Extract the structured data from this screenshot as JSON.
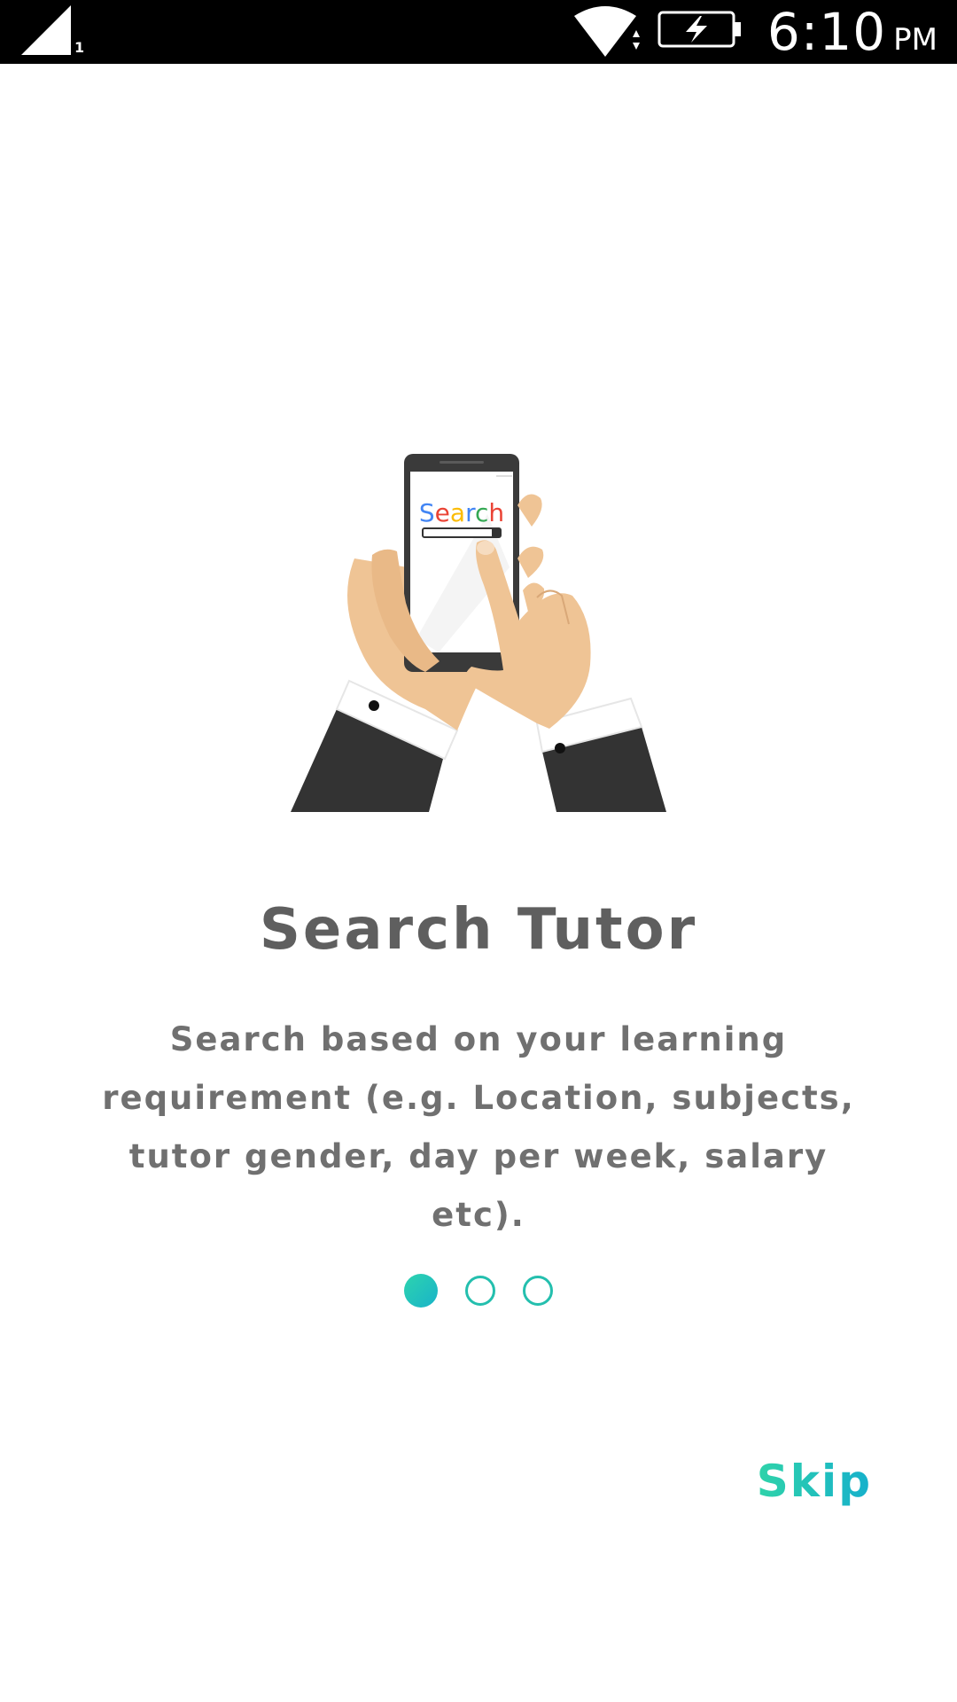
{
  "status_bar": {
    "sim_index": "1",
    "time": "6:10",
    "ampm": "PM",
    "icons": [
      "cell-signal-icon",
      "wifi-icon",
      "battery-charging-icon"
    ]
  },
  "onboarding": {
    "illustration_search_text": "Search",
    "title": "Search Tutor",
    "description_lines": [
      "Search based on your learning",
      "requirement (e.g. Location, subjects,",
      "tutor gender, day per week, salary etc)."
    ],
    "pager": {
      "total": 3,
      "active": 1
    },
    "skip_label": "Skip"
  },
  "colors": {
    "accent_start": "#2dd4ae",
    "accent_end": "#19b3c9",
    "title": "#5f5f5f",
    "body": "#707070"
  }
}
